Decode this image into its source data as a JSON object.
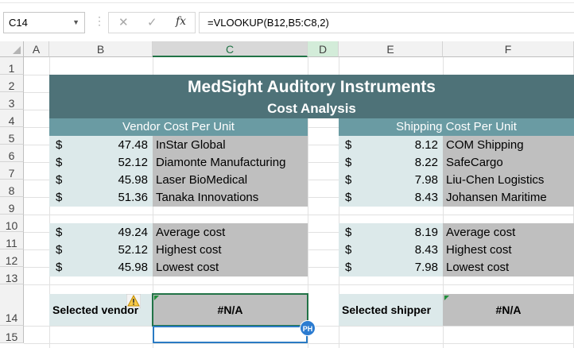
{
  "formula_bar": {
    "name_box": "C14",
    "cancel_icon": "✕",
    "enter_icon": "✓",
    "fx_label": "fx",
    "formula": "=VLOOKUP(B12,B5:C8,2)"
  },
  "columns": [
    "A",
    "B",
    "C",
    "D",
    "E",
    "F"
  ],
  "rows": [
    "1",
    "2",
    "3",
    "4",
    "5",
    "6",
    "7",
    "8",
    "9",
    "10",
    "11",
    "12",
    "13",
    "14",
    "15"
  ],
  "sheet": {
    "title": "MedSight Auditory Instruments",
    "subtitle": "Cost Analysis",
    "vendor_header": "Vendor Cost Per Unit",
    "shipping_header": "Shipping Cost Per Unit",
    "currency": "$",
    "vendors": [
      {
        "cost": "47.48",
        "name": "InStar Global"
      },
      {
        "cost": "52.12",
        "name": "Diamonte Manufacturing"
      },
      {
        "cost": "45.98",
        "name": "Laser BioMedical"
      },
      {
        "cost": "51.36",
        "name": "Tanaka Innovations"
      }
    ],
    "shippers": [
      {
        "cost": "8.12",
        "name": "COM Shipping"
      },
      {
        "cost": "8.22",
        "name": "SafeCargo"
      },
      {
        "cost": "7.98",
        "name": "Liu-Chen Logistics"
      },
      {
        "cost": "8.43",
        "name": "Johansen Maritime"
      }
    ],
    "vendor_stats": [
      {
        "value": "49.24",
        "label": "Average cost"
      },
      {
        "value": "52.12",
        "label": "Highest cost"
      },
      {
        "value": "45.98",
        "label": "Lowest cost"
      }
    ],
    "shipper_stats": [
      {
        "value": "8.19",
        "label": "Average cost"
      },
      {
        "value": "8.43",
        "label": "Highest cost"
      },
      {
        "value": "7.98",
        "label": "Lowest cost"
      }
    ],
    "selected_vendor_label": "Selected vendor",
    "selected_vendor_value": "#N/A",
    "selected_shipper_label": "Selected shipper",
    "selected_shipper_value": "#N/A"
  },
  "collaborator_initials": "PH",
  "colors": {
    "title_band": "#4e7278",
    "header_band": "#6a9ba3",
    "light_fill": "#dce9ea",
    "gray_fill": "#bfbfbf",
    "selection": "#217346"
  }
}
